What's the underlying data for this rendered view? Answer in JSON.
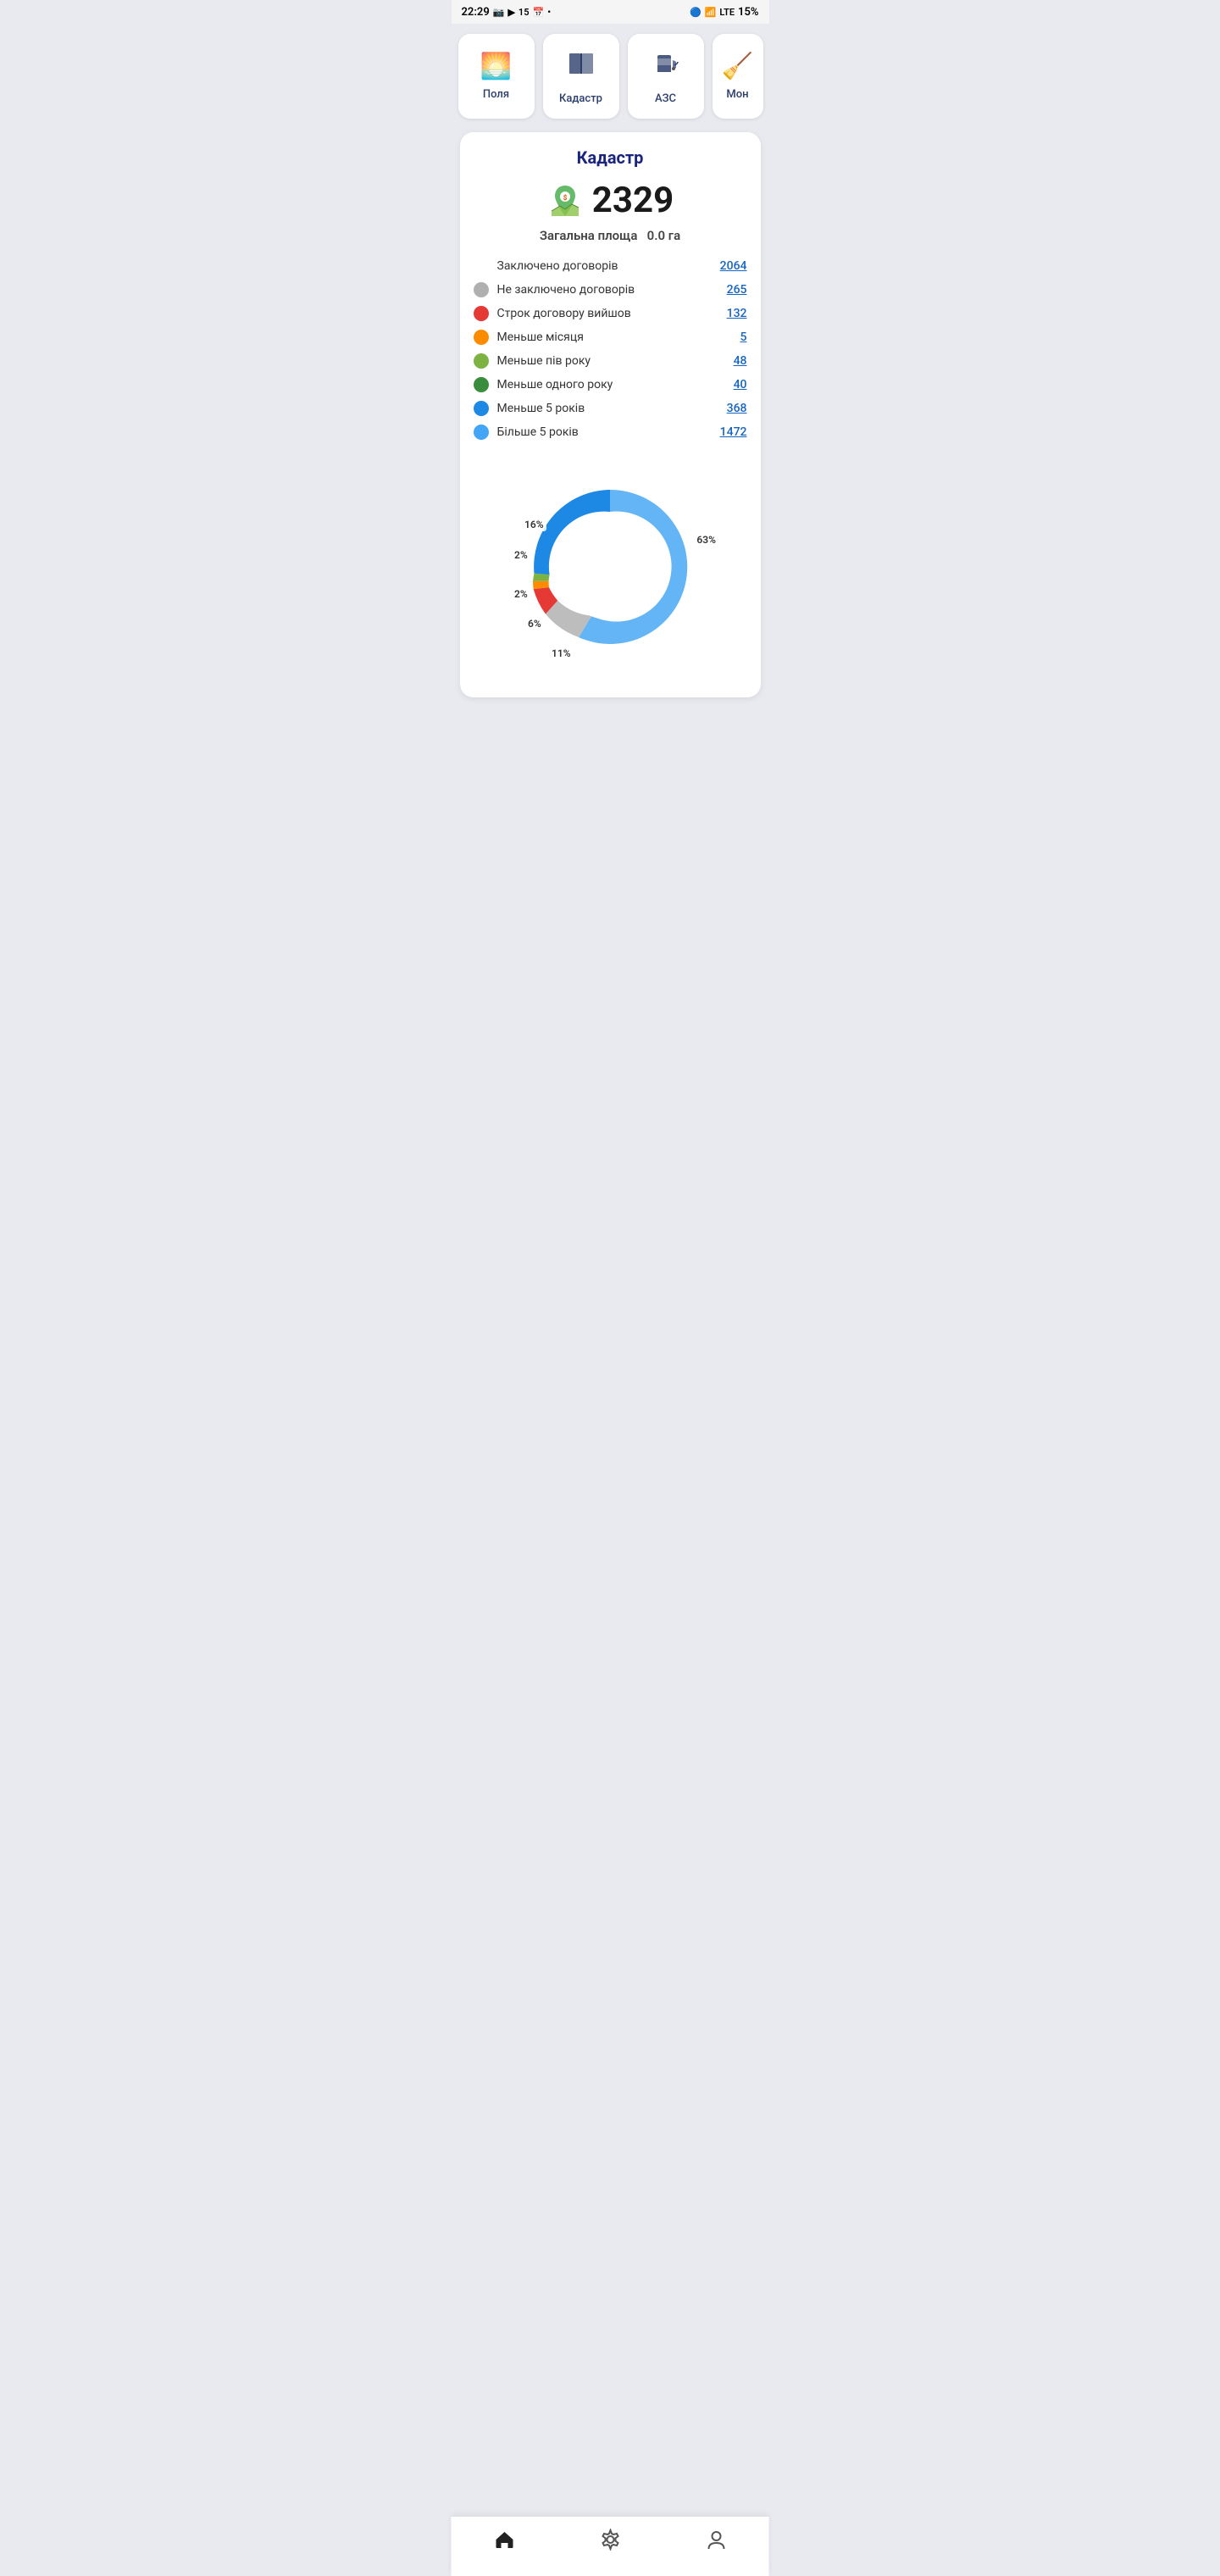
{
  "statusBar": {
    "time": "22:29",
    "battery": "15%"
  },
  "topMenu": {
    "items": [
      {
        "id": "fields",
        "label": "Поля",
        "icon": "🌅"
      },
      {
        "id": "cadastre",
        "label": "Кадастр",
        "icon": "🗺"
      },
      {
        "id": "azs",
        "label": "АЗС",
        "icon": "⛽"
      },
      {
        "id": "mon",
        "label": "Мон",
        "icon": "🧹"
      }
    ]
  },
  "cadastreCard": {
    "title": "Кадастр",
    "heroNumber": "2329",
    "areaLabel": "Загальна площа",
    "areaValue": "0.0 га",
    "stats": [
      {
        "id": "contracted",
        "label": "Заключено договорів",
        "value": "2064",
        "color": null
      },
      {
        "id": "not-contracted",
        "label": "Не заключено договорів",
        "value": "265",
        "color": "#b0b0b0"
      },
      {
        "id": "expired",
        "label": "Строк договору вийшов",
        "value": "132",
        "color": "#e53935"
      },
      {
        "id": "less-month",
        "label": "Меньше місяця",
        "value": "5",
        "color": "#fb8c00"
      },
      {
        "id": "less-half-year",
        "label": "Меньше пів року",
        "value": "48",
        "color": "#7cb342"
      },
      {
        "id": "less-year",
        "label": "Меньше одного року",
        "value": "40",
        "color": "#388e3c"
      },
      {
        "id": "less-5years",
        "label": "Меньше 5 років",
        "value": "368",
        "color": "#1e88e5"
      },
      {
        "id": "more-5years",
        "label": "Більше 5 років",
        "value": "1472",
        "color": "#42a5f5"
      }
    ],
    "chart": {
      "segments": [
        {
          "label": "63%",
          "value": 63,
          "color": "#64b5f6",
          "startAngle": -90
        },
        {
          "label": "11%",
          "value": 11,
          "color": "#bdbdbd",
          "startAngle": 137
        },
        {
          "label": "6%",
          "value": 6,
          "color": "#e53935",
          "startAngle": 207
        },
        {
          "label": "2%",
          "value": 2,
          "color": "#fb8c00",
          "startAngle": 228
        },
        {
          "label": "2%",
          "value": 2,
          "color": "#7cb342",
          "startAngle": 235
        },
        {
          "label": "16%",
          "value": 16,
          "color": "#1e88e5",
          "startAngle": 242
        }
      ]
    }
  },
  "bottomNav": {
    "items": [
      {
        "id": "home",
        "label": "Головна",
        "icon": "🏠"
      },
      {
        "id": "settings",
        "label": "Налаштування",
        "icon": "⚙️"
      },
      {
        "id": "profile",
        "label": "Профіль",
        "icon": "👤"
      }
    ]
  }
}
